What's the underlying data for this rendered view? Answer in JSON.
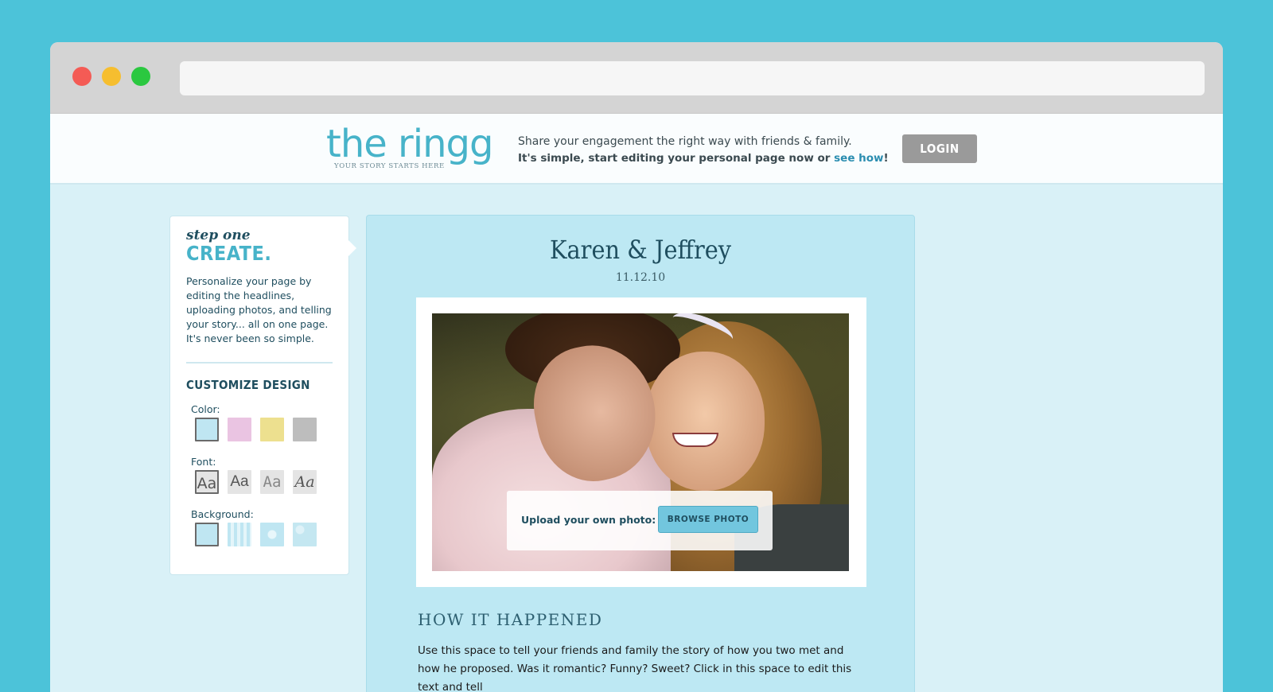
{
  "header": {
    "logo_text": "the ringg",
    "logo_tagline": "YOUR STORY STARTS HERE",
    "tagline_line1": "Share your engagement the right way with friends & family.",
    "tagline_line2_pre": "It's simple, start editing your personal page now or ",
    "tagline_link": "see how",
    "tagline_line2_post": "!",
    "login_label": "LOGIN"
  },
  "sidebar": {
    "step": "step one",
    "heading": "CREATE.",
    "description": "Personalize your page by editing the headlines, uploading photos, and telling your story... all on one page. It's never been so simple.",
    "customize_title": "CUSTOMIZE DESIGN",
    "color_label": "Color:",
    "font_label": "Font:",
    "background_label": "Background:",
    "colors": [
      "#bfe6f2",
      "#eac4e2",
      "#ede08f",
      "#bdbdbd"
    ],
    "font_samples": [
      "Aa",
      "Aa",
      "Aa",
      "Aa"
    ]
  },
  "main": {
    "names": "Karen & Jeffrey",
    "date": "11.12.10",
    "upload_label": "Upload your own photo:",
    "browse_label": "BROWSE PHOTO",
    "section_title": "HOW IT HAPPENED",
    "story": "Use this space to tell your friends and family the story of how you two met and how he proposed. Was it romantic? Funny? Sweet? Click in this space to edit this text and tell"
  }
}
